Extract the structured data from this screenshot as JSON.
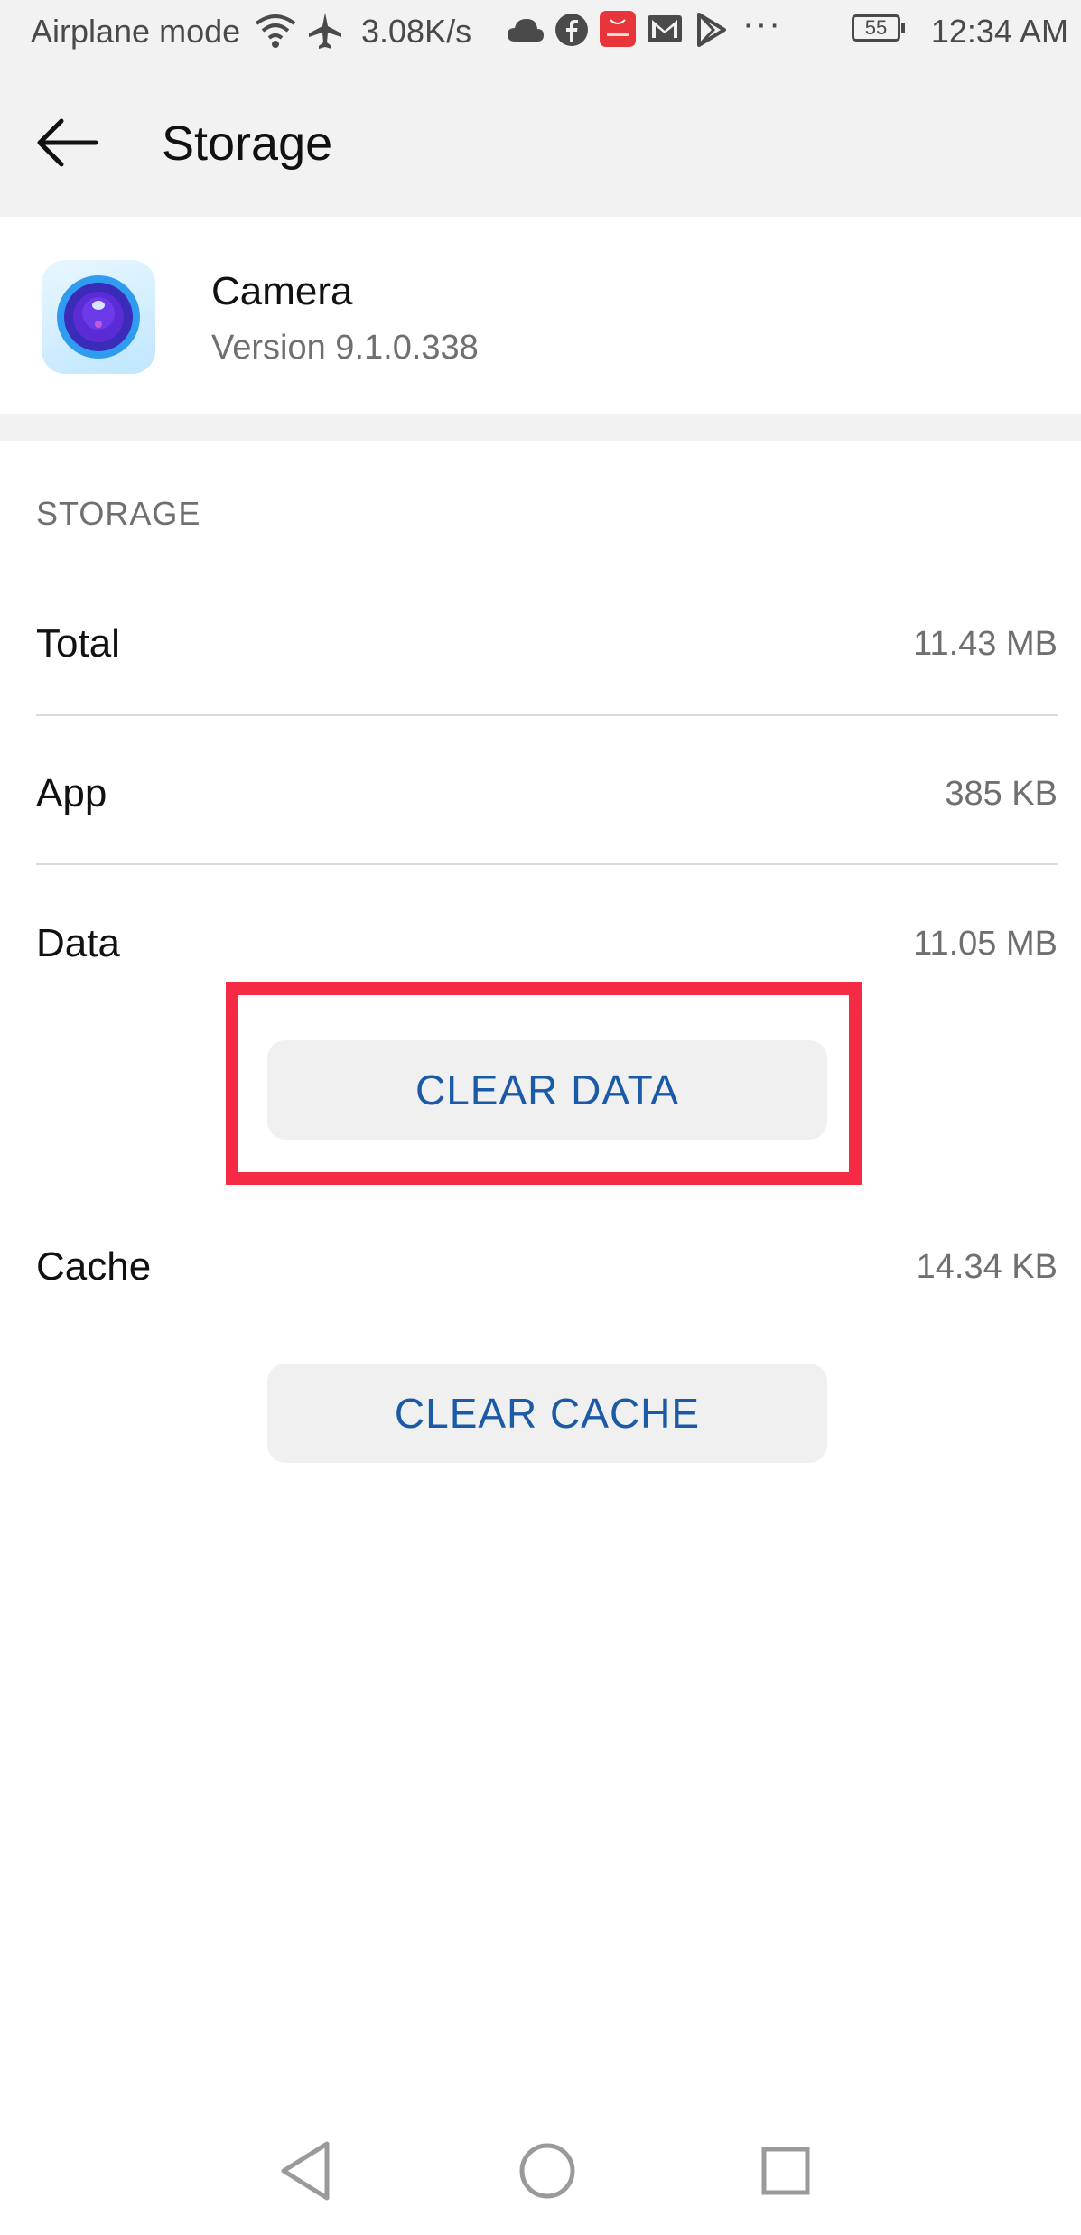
{
  "status_bar": {
    "mode_text": "Airplane mode",
    "speed": "3.08K/s",
    "battery": "55",
    "time": "12:34 AM",
    "icons": [
      "wifi-icon",
      "airplane-icon",
      "cloud-icon",
      "facebook-icon",
      "huawei-store-icon",
      "gmail-icon",
      "play-store-icon",
      "more-notifications-icon"
    ]
  },
  "app_bar": {
    "title": "Storage",
    "back_icon": "back-arrow-icon"
  },
  "app_info": {
    "name": "Camera",
    "version": "Version 9.1.0.338",
    "icon": "camera-app-icon"
  },
  "storage": {
    "header": "STORAGE",
    "rows": [
      {
        "label": "Total",
        "value": "11.43 MB"
      },
      {
        "label": "App",
        "value": "385 KB"
      },
      {
        "label": "Data",
        "value": "11.05 MB"
      },
      {
        "label": "Cache",
        "value": "14.34 KB"
      }
    ],
    "clear_data_label": "CLEAR DATA",
    "clear_cache_label": "CLEAR CACHE"
  },
  "nav_bar": {
    "icons": [
      "back-triangle-icon",
      "home-circle-icon",
      "recents-square-icon"
    ]
  },
  "colors": {
    "accent": "#1b5aa6",
    "highlight": "#f52a44",
    "background_gray": "#f2f2f2"
  }
}
